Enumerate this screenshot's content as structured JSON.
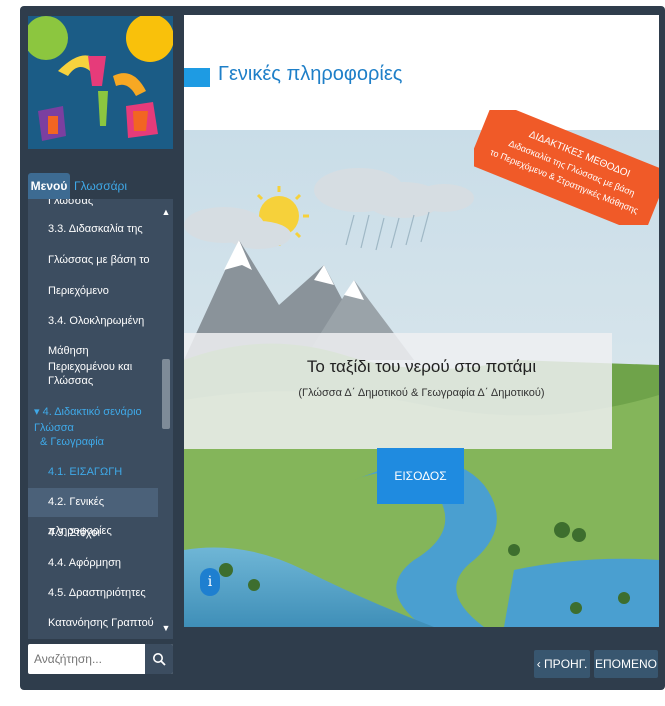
{
  "sidebar": {
    "tabs": {
      "menu": "Μενού",
      "glossary": "Γλωσσάρι"
    },
    "menu_items": [
      {
        "label": "Γλώσσας",
        "style": "cut"
      },
      {
        "label": "3.3. Διδασκαλία της",
        "style": "normal"
      },
      {
        "label": "Γλώσσας με βάση το",
        "style": "normal"
      },
      {
        "label": "Περιεχόμενο",
        "style": "normal"
      },
      {
        "label": "3.4. Ολοκληρωμένη",
        "style": "normal"
      },
      {
        "label": "Μάθηση Περιεχομένου και",
        "style": "normal"
      },
      {
        "label": "Γλώσσας",
        "style": "normal"
      },
      {
        "label": "▾ 4. Διδακτικό σενάριο Γλώσσα",
        "style": "dim"
      },
      {
        "label": "& Γεωγραφία",
        "style": "dim"
      },
      {
        "label": "4.1. ΕΙΣΑΓΩΓΗ",
        "style": "dim"
      },
      {
        "label": "4.2. Γενικές πληροφορίες",
        "style": "active"
      },
      {
        "label": "4.3. Στόχοι",
        "style": "normal"
      },
      {
        "label": "4.4. Αφόρμηση",
        "style": "normal"
      },
      {
        "label": "4.5. Δραστηριότητες",
        "style": "normal"
      },
      {
        "label": "Κατανόησης Γραπτού",
        "style": "normal"
      }
    ],
    "search": {
      "placeholder": "Αναζήτηση...",
      "icon": "search-icon"
    }
  },
  "slide": {
    "title": "Γενικές πληροφορίες",
    "banner_lines": [
      "ΔΙΔΑΚΤΙΚΕΣ ΜΕΘΟΔΟΙ",
      "Διδασκαλία της Γλώσσας με βάση",
      "το Περιεχόμενο & Στρατηγικές Μάθησης"
    ],
    "panel_title": "Το ταξίδι του νερού στο ποτάμι",
    "panel_subtitle": "(Γλώσσα Δ΄ Δημοτικού & Γεωγραφία Δ΄ Δημοτικού)",
    "enter_label": "ΕΙΣΟΔΟΣ",
    "info_label": "i"
  },
  "nav": {
    "prev_label": "‹ ΠΡΟΗΓ.",
    "next_label": "ΕΠΟΜΕΝΟ ›"
  },
  "colors": {
    "frame": "#2f3d4c",
    "accent": "#1e9be3",
    "banner": "#f05a28",
    "button": "#1f8be0"
  }
}
